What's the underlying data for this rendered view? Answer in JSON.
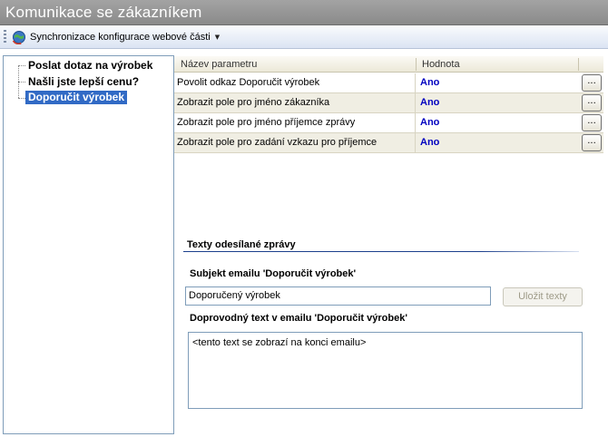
{
  "window": {
    "title": "Komunikace se zákazníkem"
  },
  "toolbar": {
    "sync_label": "Synchronizace konfigurace webové části"
  },
  "sidebar": {
    "items": [
      {
        "label": "Poslat dotaz na výrobek"
      },
      {
        "label": "Našli jste lepší cenu?"
      },
      {
        "label": "Doporučit výrobek",
        "selected": true
      }
    ]
  },
  "grid": {
    "headers": {
      "name": "Název parametru",
      "value": "Hodnota"
    },
    "rows": [
      {
        "name": "Povolit odkaz Doporučit výrobek",
        "value": "Ano"
      },
      {
        "name": "Zobrazit pole pro jméno zákazníka",
        "value": "Ano"
      },
      {
        "name": "Zobrazit pole pro jméno příjemce zprávy",
        "value": "Ano"
      },
      {
        "name": "Zobrazit pole pro zadání vzkazu pro příjemce",
        "value": "Ano"
      }
    ],
    "edit_label": "..."
  },
  "email": {
    "section_title": "Texty odesílané zprávy",
    "subject_label": "Subjekt emailu 'Doporučit výrobek'",
    "subject_value": "Doporučený výrobek",
    "save_label": "Uložit texty",
    "body_label": "Doprovodný text v emailu 'Doporučit výrobek'",
    "body_value": "<tento text se zobrazí na konci emailu>"
  },
  "colors": {
    "title_bar": "#999999",
    "selection": "#316ac5",
    "value_text": "#0000c0"
  }
}
